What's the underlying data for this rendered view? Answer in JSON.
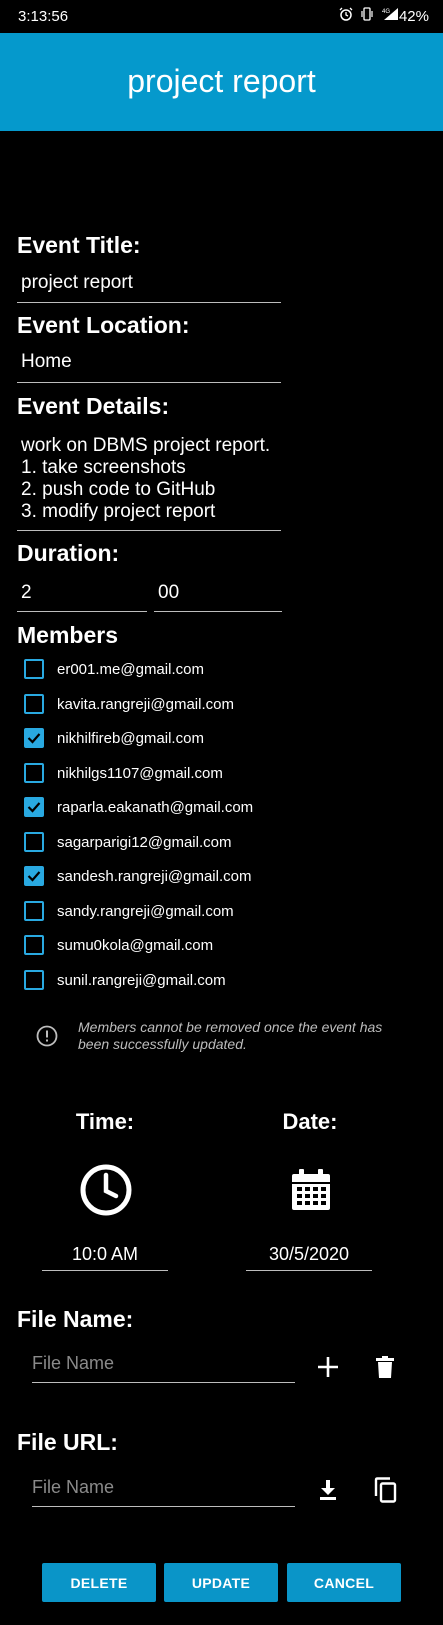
{
  "status_bar": {
    "time": "3:13:56",
    "battery": "42%"
  },
  "app_bar": {
    "title": "project report"
  },
  "event_title": {
    "label": "Event Title:",
    "value": "project report"
  },
  "event_location": {
    "label": "Event Location:",
    "value": "Home"
  },
  "event_details": {
    "label": "Event Details:",
    "lines": [
      "work on DBMS project report.",
      "1. take screenshots",
      "2. push code to GitHub",
      "3. modify project report"
    ]
  },
  "duration": {
    "label": "Duration:",
    "hours": "2",
    "minutes": "00"
  },
  "members": {
    "label": "Members",
    "items": [
      {
        "email": "er001.me@gmail.com",
        "checked": false
      },
      {
        "email": "kavita.rangreji@gmail.com",
        "checked": false
      },
      {
        "email": "nikhilfireb@gmail.com",
        "checked": true
      },
      {
        "email": "nikhilgs1107@gmail.com",
        "checked": false
      },
      {
        "email": "raparla.eakanath@gmail.com",
        "checked": true
      },
      {
        "email": "sagarparigi12@gmail.com",
        "checked": false
      },
      {
        "email": "sandesh.rangreji@gmail.com",
        "checked": true
      },
      {
        "email": "sandy.rangreji@gmail.com",
        "checked": false
      },
      {
        "email": "sumu0kola@gmail.com",
        "checked": false
      },
      {
        "email": "sunil.rangreji@gmail.com",
        "checked": false
      }
    ],
    "info": "Members cannot be removed once the event has been successfully updated."
  },
  "time": {
    "label": "Time:",
    "value": "10:0 AM"
  },
  "date": {
    "label": "Date:",
    "value": "30/5/2020"
  },
  "file_name": {
    "label": "File Name:",
    "placeholder": "File Name"
  },
  "file_url": {
    "label": "File URL:",
    "placeholder": "File Name"
  },
  "buttons": {
    "delete": "DELETE",
    "update": "UPDATE",
    "cancel": "CANCEL"
  },
  "colors": {
    "accent": "#0599cc",
    "checkbox": "#29a9e1",
    "background": "#000000"
  }
}
